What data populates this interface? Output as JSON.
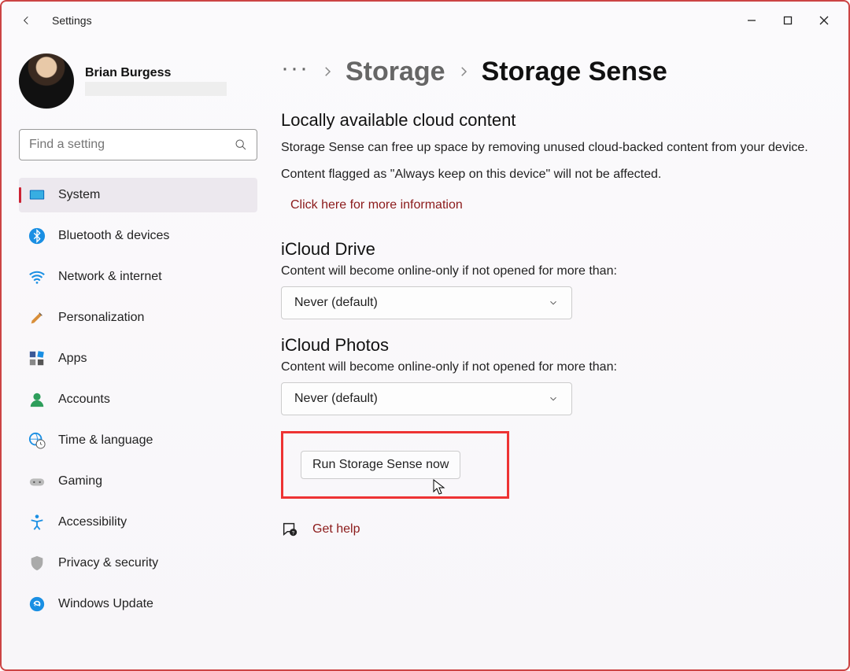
{
  "app": {
    "title": "Settings"
  },
  "user": {
    "name": "Brian Burgess"
  },
  "search": {
    "placeholder": "Find a setting"
  },
  "nav": {
    "items": [
      {
        "label": "System",
        "icon": "system"
      },
      {
        "label": "Bluetooth & devices",
        "icon": "bluetooth"
      },
      {
        "label": "Network & internet",
        "icon": "wifi"
      },
      {
        "label": "Personalization",
        "icon": "brush"
      },
      {
        "label": "Apps",
        "icon": "apps"
      },
      {
        "label": "Accounts",
        "icon": "person"
      },
      {
        "label": "Time & language",
        "icon": "globe-clock"
      },
      {
        "label": "Gaming",
        "icon": "gamepad"
      },
      {
        "label": "Accessibility",
        "icon": "accessibility"
      },
      {
        "label": "Privacy & security",
        "icon": "shield"
      },
      {
        "label": "Windows Update",
        "icon": "update"
      }
    ],
    "active_index": 0
  },
  "breadcrumb": {
    "more": "···",
    "link": "Storage",
    "current": "Storage Sense"
  },
  "cloud": {
    "title": "Locally available cloud content",
    "desc1": "Storage Sense can free up space by removing unused cloud-backed content from your device.",
    "desc2": "Content flagged as \"Always keep on this device\" will not be affected.",
    "info_link": "Click here for more information"
  },
  "drive": {
    "title": "iCloud Drive",
    "desc": "Content will become online-only if not opened for more than:",
    "value": "Never (default)"
  },
  "photos": {
    "title": "iCloud Photos",
    "desc": "Content will become online-only if not opened for more than:",
    "value": "Never (default)"
  },
  "run": {
    "label": "Run Storage Sense now"
  },
  "help": {
    "label": "Get help"
  }
}
